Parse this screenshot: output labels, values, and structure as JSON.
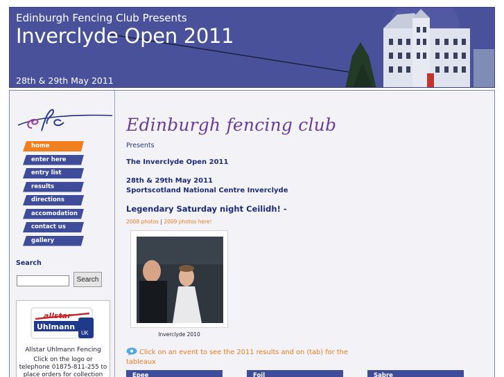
{
  "header": {
    "subtitle": "Edinburgh Fencing Club Presents",
    "title": "Inverclyde Open 2011",
    "date": "28th & 29th May 2011"
  },
  "sidebar": {
    "nav": [
      "home",
      "enter here",
      "entry list",
      "results",
      "directions",
      "accomodation",
      "contact us",
      "gallery"
    ],
    "active": "home",
    "search": {
      "title": "Search",
      "input_value": "",
      "button": "Search"
    },
    "sponsor": {
      "logo_text_top": "allstar",
      "logo_text_bottom": "Uhlmann",
      "logo_badge": "UK",
      "name": "Allstar Uhlmann Fencing",
      "text": "Click on the logo or telephone 01875-811-255 to place orders for collection"
    }
  },
  "main": {
    "script_title": "Edinburgh fencing club",
    "presents": "Presents",
    "heading": "The Inverclyde Open 2011",
    "date_line": "28th & 29th May 2011",
    "venue_line": "Sportscotland National Centre Inverclyde",
    "ceilidh": "Legendary Saturday night Ceilidh! -",
    "photo_links": [
      "2008 photos",
      "2009 photos here!"
    ],
    "photo_sep": "|",
    "photo_caption": "Inverclyde 2010",
    "event_text": "Click on an event to see the 2011 results and on (tab) for the tableaux",
    "events": [
      "Epee",
      "Foil",
      "Sabre"
    ]
  },
  "colors": {
    "banner": "#4a519b",
    "nav": "#3f4c9a",
    "nav_active": "#f07f1f",
    "accent_orange": "#e87b1f",
    "heading_blue": "#1e2c78",
    "script_purple": "#6a3e98"
  },
  "icons": {
    "logo": "efc-logo",
    "event": "speech-bubble-icon",
    "building": "hotel-building-art"
  }
}
